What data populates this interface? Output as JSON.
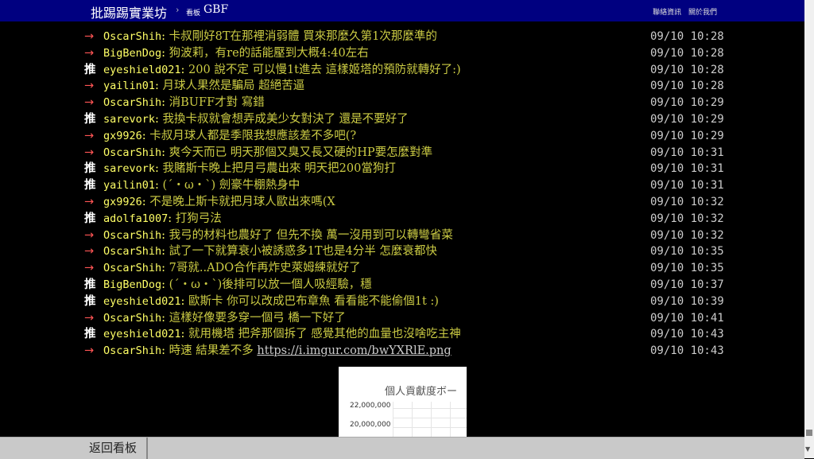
{
  "header": {
    "site_title": "批踢踢實業坊",
    "separator": "›",
    "board_prefix": "看板",
    "board_name": "GBF",
    "links": [
      "聯絡資訊",
      "關於我們"
    ]
  },
  "comments": [
    {
      "tag": "→",
      "user": "OscarShih",
      "content": "卡叔剛好8T在那裡消弱體 買來那麼久第1次那麼準的",
      "time": "09/10 10:28"
    },
    {
      "tag": "→",
      "user": "BigBenDog",
      "content": "狗波莉，有re的話能壓到大概4:40左右",
      "time": "09/10 10:28"
    },
    {
      "tag": "推",
      "user": "eyeshield021",
      "content": "200 說不定 可以慢1t進去 這樣姬塔的預防就轉好了:)",
      "time": "09/10 10:28"
    },
    {
      "tag": "→",
      "user": "yailin01",
      "content": "月球人果然是騙局 超絕苦逼",
      "time": "09/10 10:28"
    },
    {
      "tag": "→",
      "user": "OscarShih",
      "content": "消BUFF才對 寫錯",
      "time": "09/10 10:29"
    },
    {
      "tag": "推",
      "user": "sarevork",
      "content": "我換卡叔就會想弄成美少女對決了 還是不要好了",
      "time": "09/10 10:29"
    },
    {
      "tag": "→",
      "user": "gx9926",
      "content": "卡叔月球人都是季限我想應該差不多吧(?",
      "time": "09/10 10:29"
    },
    {
      "tag": "→",
      "user": "OscarShih",
      "content": "爽今天而已 明天那個又臭又長又硬的HP要怎麼對準",
      "time": "09/10 10:31"
    },
    {
      "tag": "推",
      "user": "sarevork",
      "content": "我賭斯卡晚上把月弓農出來 明天把200當狗打",
      "time": "09/10 10:31"
    },
    {
      "tag": "推",
      "user": "yailin01",
      "content": "(´・ω・`) 劍豪牛棚熱身中",
      "time": "09/10 10:31"
    },
    {
      "tag": "→",
      "user": "gx9926",
      "content": "不是晚上斯卡就把月球人歐出來嗎(X",
      "time": "09/10 10:32"
    },
    {
      "tag": "推",
      "user": "adolfa1007",
      "content": "打狗弓法",
      "time": "09/10 10:32"
    },
    {
      "tag": "→",
      "user": "OscarShih",
      "content": "我弓的材料也農好了 但先不換 萬一沒用到可以轉彎省菜",
      "time": "09/10 10:32"
    },
    {
      "tag": "→",
      "user": "OscarShih",
      "content": "試了一下就算衰小被誘惑多1T也是4分半 怎麼衰都快",
      "time": "09/10 10:35"
    },
    {
      "tag": "→",
      "user": "OscarShih",
      "content": "7哥就..ADO合作再炸史萊姆練就好了",
      "time": "09/10 10:35"
    },
    {
      "tag": "推",
      "user": "BigBenDog",
      "content": "(´・ω・`)後排可以放一個人吸經驗，穩",
      "time": "09/10 10:37"
    },
    {
      "tag": "推",
      "user": "eyeshield021",
      "content": "歐斯卡 你可以改成巴布章魚 看看能不能偷個1t :)",
      "time": "09/10 10:39"
    },
    {
      "tag": "→",
      "user": "OscarShih",
      "content": "這樣好像要多穿一個弓 橋一下好了",
      "time": "09/10 10:41"
    },
    {
      "tag": "推",
      "user": "eyeshield021",
      "content": "就用機塔 把斧那個拆了 感覺其他的血量也沒啥吃主神",
      "time": "09/10 10:43"
    },
    {
      "tag": "→",
      "user": "OscarShih",
      "content": "時速 結果差不多 ",
      "link": "https://i.imgur.com/bwYXRlE.png",
      "time": "09/10 10:43"
    }
  ],
  "image_preview": {
    "title": "個人貢獻度ボー",
    "y_ticks": [
      "22,000,000",
      "20,000,000"
    ]
  },
  "footer": {
    "back_label": "返回看板"
  }
}
